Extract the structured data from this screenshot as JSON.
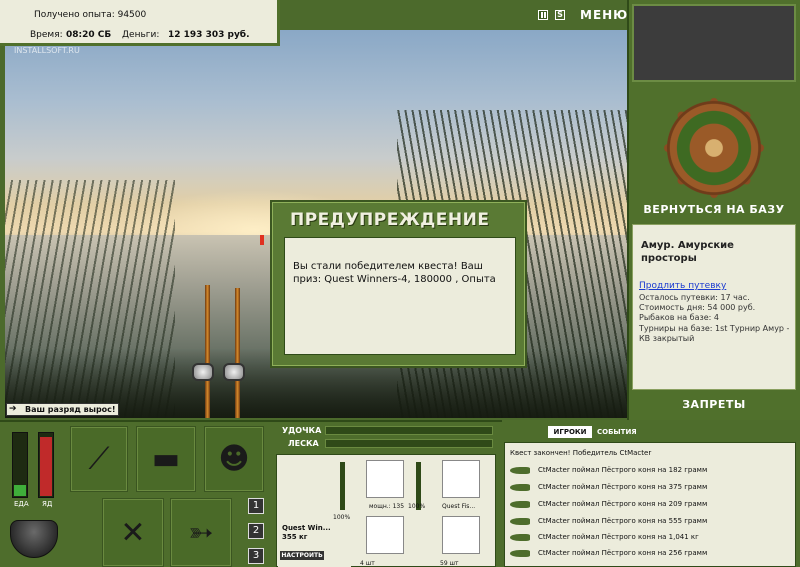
{
  "stats": {
    "xp": "Получено опыта: 94500",
    "time_label": "Время:",
    "time_value": "08:20 СБ",
    "money_label": "Деньги:",
    "money_value": "12 193 303 руб."
  },
  "watermark": "INSTALLSOFT.RU",
  "controls": {
    "s_label": "S",
    "menu": "МЕНЮ"
  },
  "dialog": {
    "title": "ПРЕДУПРЕЖДЕНИЕ",
    "message": "Вы стали победителем квеста! Ваш приз: Quest Winners-4, 180000 , Опыта"
  },
  "rank_message": "Ваш разряд вырос!",
  "right_panel": {
    "return_button": "ВЕРНУТЬСЯ НА БАЗУ",
    "location": "Амур. Амурские просторы",
    "extend_link": "Продлить путевку",
    "lines": [
      "Осталось путевки: 17 час.",
      "Стоимость дня: 54 000 руб.",
      "Рыбаков на базе: 4",
      "Турниры на базе: 1st Турнир Амур - КВ закрытый"
    ],
    "bans_button": "ЗАПРЕТЫ"
  },
  "gauges": {
    "food_label": "ЕДА",
    "poison_label": "ЯД",
    "food_level": 0.18,
    "poison_level": 0.95
  },
  "tabs_numbers": [
    "1",
    "2",
    "3"
  ],
  "tackle": {
    "rod_label": "УДОЧКА",
    "line_label": "ЛЕСКА",
    "rod_name": "Quest Win...",
    "rod_weight": "355 кг",
    "tune_button": "НАСТРОИТЬ",
    "pct_rod": "100%",
    "reel_label": "мощн.: 135",
    "reel_pct": "100%",
    "line_name": "Quest Fis...",
    "hook_count": "4 шт",
    "bait_count": "59 шт"
  },
  "events": {
    "tab_players": "ИГРОКИ",
    "tab_events": "СОБЫТИЯ",
    "header": "Квест закончен! Победитель CtMacter",
    "rows": [
      "CtMacter поймал Пёстрого коня на 182 грамм",
      "CtMacter поймал Пёстрого коня на 375 грамм",
      "CtMacter поймал Пёстрого коня на 209 грамм",
      "CtMacter поймал Пёстрого коня на 555 грамм",
      "CtMacter поймал Пёстрого коня на 1,041 кг",
      "CtMacter поймал Пёстрого коня на 256 грамм"
    ]
  }
}
